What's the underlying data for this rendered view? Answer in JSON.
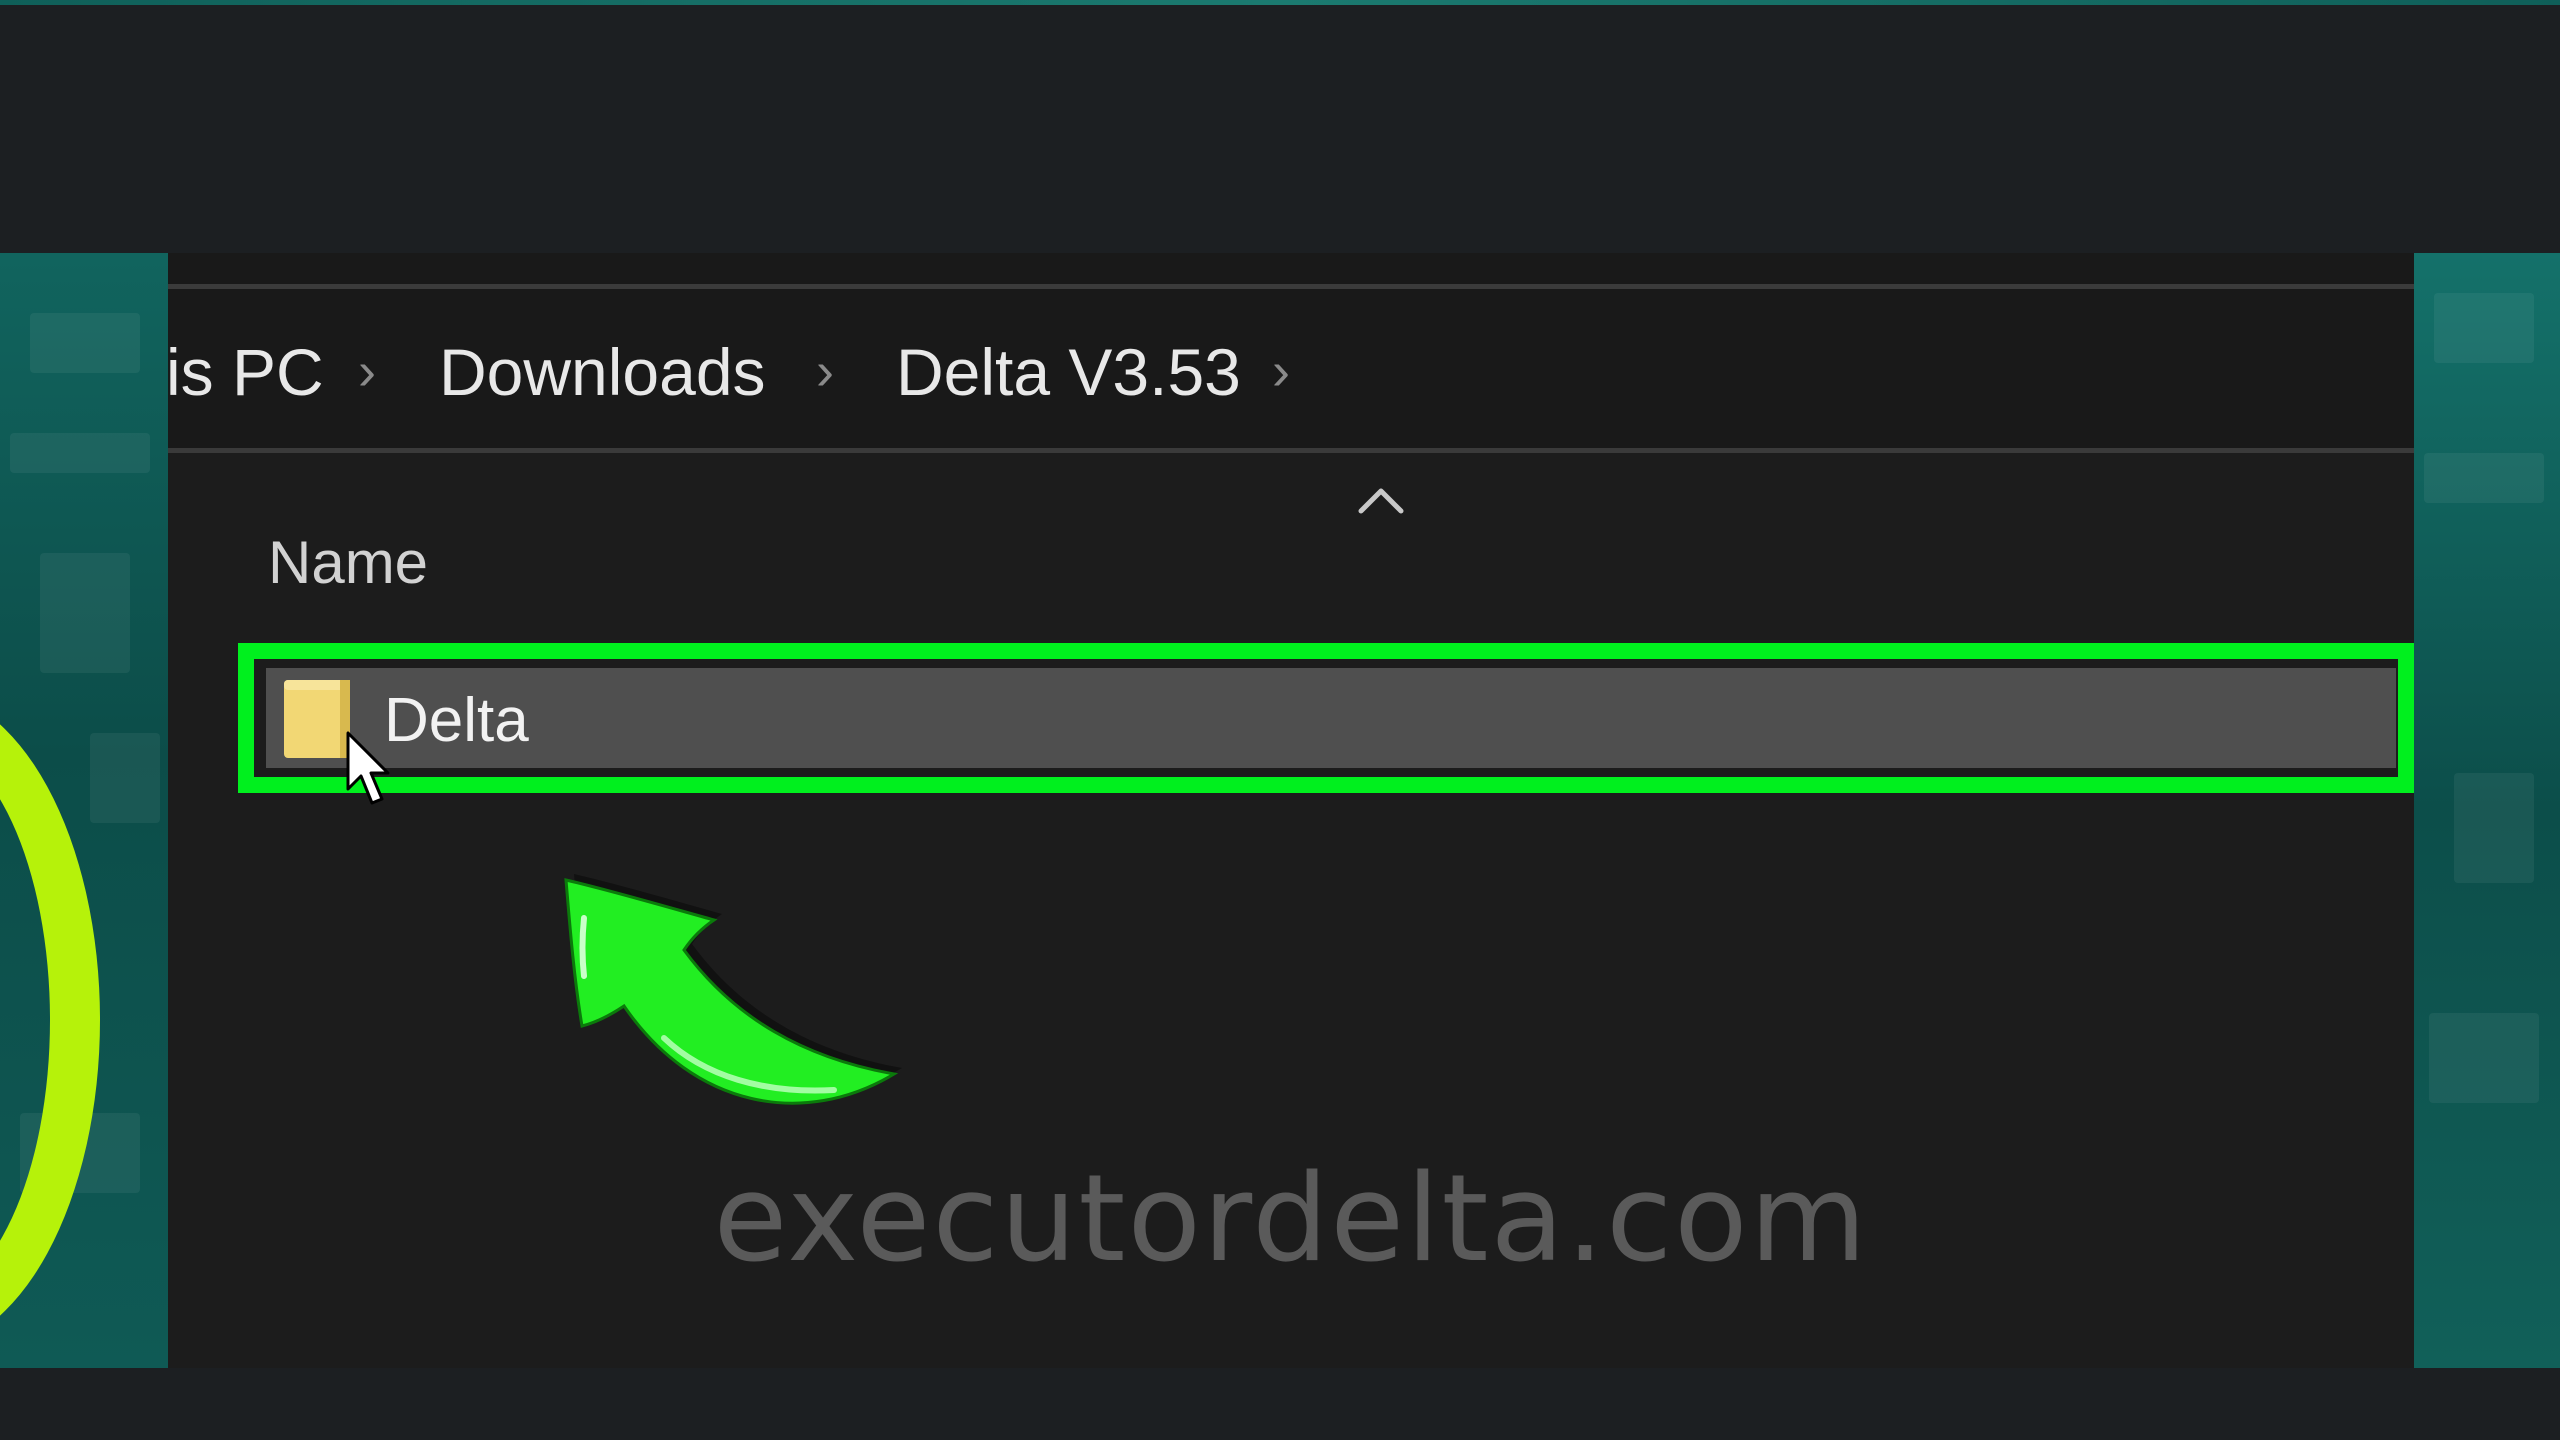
{
  "breadcrumb": {
    "items": [
      {
        "label": "is PC"
      },
      {
        "label": "Downloads"
      },
      {
        "label": "Delta V3.53"
      }
    ],
    "separator": "›"
  },
  "file_list": {
    "column_header": "Name",
    "sort": "ascending",
    "rows": [
      {
        "name": "Delta",
        "type": "folder",
        "selected": true
      }
    ]
  },
  "overlay": {
    "watermark": "executordelta.com",
    "highlight_color": "#00f01e",
    "arrow_color": "#22ee22",
    "ring_color": "#b6f20a"
  }
}
